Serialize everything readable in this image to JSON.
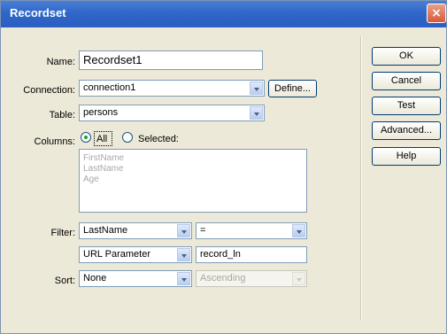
{
  "window": {
    "title": "Recordset",
    "close_glyph": "×"
  },
  "form": {
    "name_label": "Name:",
    "name_value": "Recordset1",
    "connection_label": "Connection:",
    "connection_value": "connection1",
    "define_button": "Define...",
    "table_label": "Table:",
    "table_value": "persons",
    "columns_label": "Columns:",
    "columns_all_label": "All",
    "columns_selected_label": "Selected:",
    "columns_list": [
      "FirstName",
      "LastName",
      "Age"
    ],
    "filter_label": "Filter:",
    "filter_column": "LastName",
    "filter_operator": "=",
    "filter_source": "URL Parameter",
    "filter_value": "record_ln",
    "sort_label": "Sort:",
    "sort_column": "None",
    "sort_order": "Ascending"
  },
  "buttons": {
    "ok": "OK",
    "cancel": "Cancel",
    "test": "Test",
    "advanced": "Advanced...",
    "help": "Help"
  },
  "icons": {
    "close": "close-icon",
    "dropdown": "chevron-down-icon",
    "radio": "radio-icon"
  },
  "colors": {
    "titlebar": "#2f66c8",
    "dialog_bg": "#ece9d8",
    "close_button": "#d9583a",
    "radio_dot": "#21a121",
    "disabled_text": "#aca899"
  }
}
